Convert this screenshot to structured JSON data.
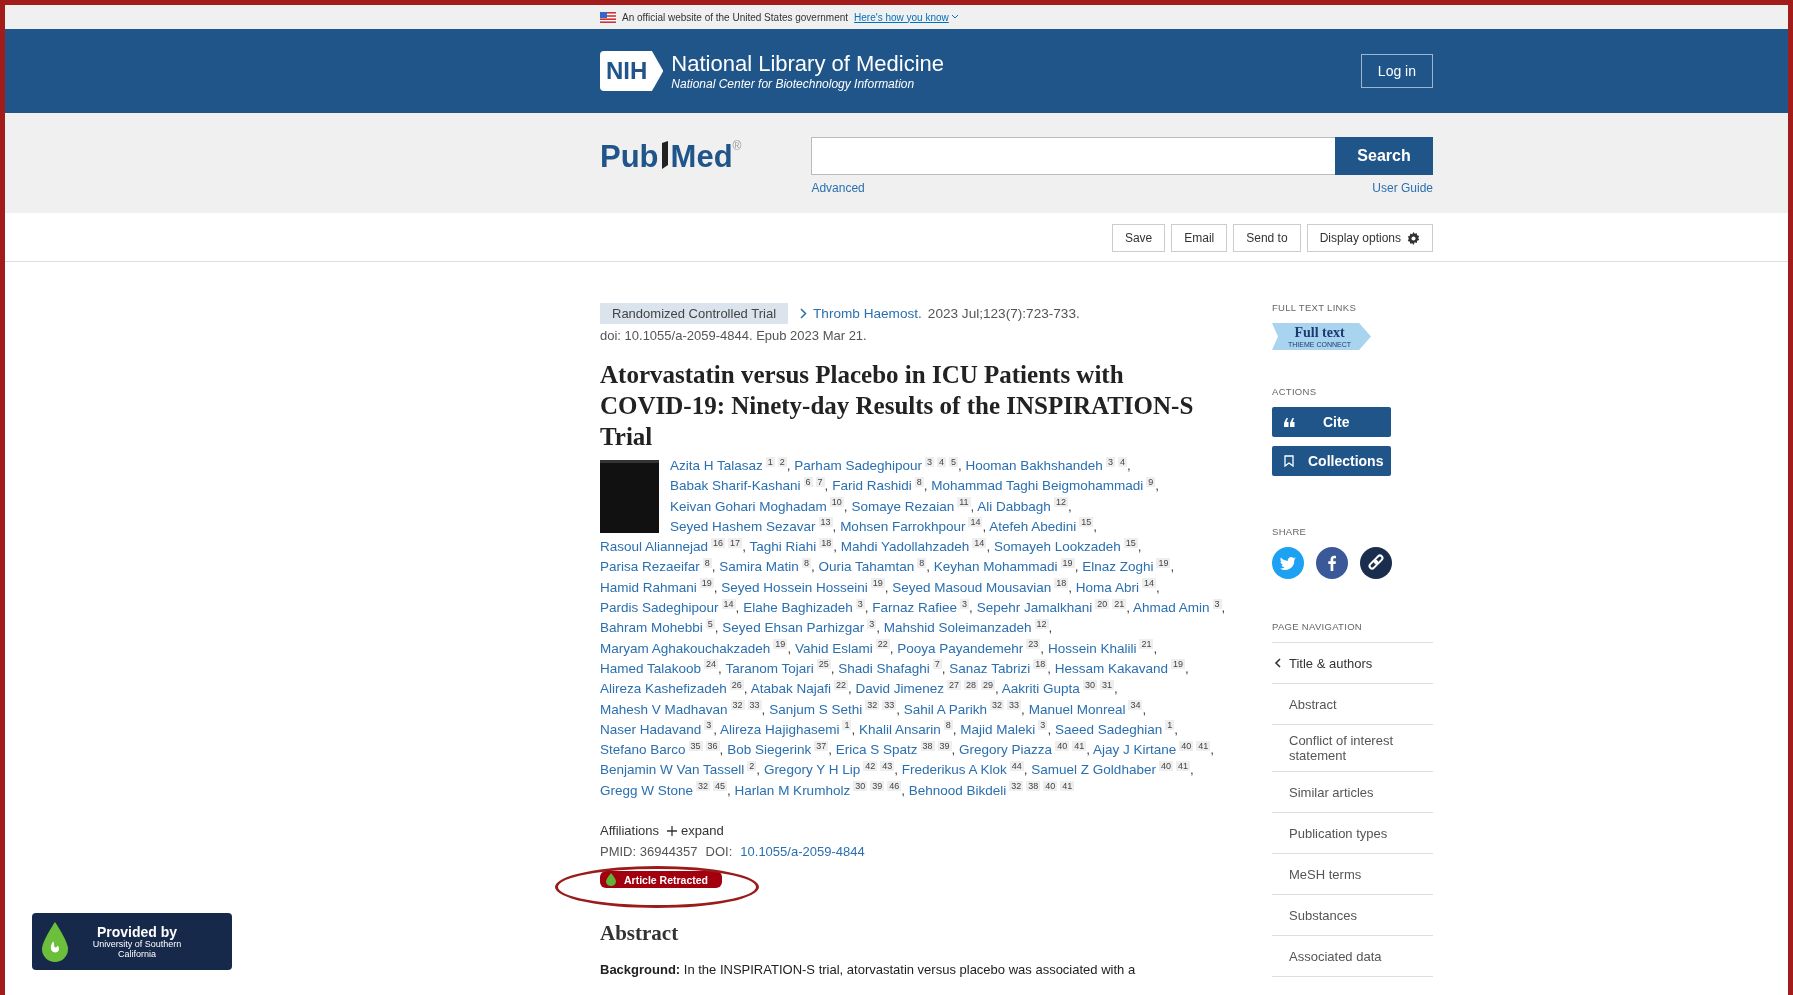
{
  "gov_banner": {
    "text": "An official website of the United States government",
    "link": "Here's how you know"
  },
  "header": {
    "logo_text": "NIH",
    "title": "National Library of Medicine",
    "subtitle": "National Center for Biotechnology Information",
    "login": "Log in"
  },
  "search": {
    "logo_parts": [
      "Pub",
      "Med"
    ],
    "logo_mark": "®",
    "button": "Search",
    "advanced": "Advanced",
    "user_guide": "User Guide"
  },
  "toolbar": [
    "Save",
    "Email",
    "Send to",
    "Display options"
  ],
  "article": {
    "publication_type": "Randomized Controlled Trial",
    "journal": "Thromb Haemost.",
    "citation": "2023 Jul;123(7):723-733.",
    "doi_line": "doi: 10.1055/a-2059-4844. Epub 2023 Mar 21.",
    "title": "Atorvastatin versus Placebo in ICU Patients with COVID-19: Ninety-day Results of the INSPIRATION-S Trial",
    "authors": [
      {
        "name": "Azita H Talasaz",
        "affiliations": [
          "1",
          "2"
        ]
      },
      {
        "name": "Parham Sadeghipour",
        "affiliations": [
          "3",
          "4",
          "5"
        ]
      },
      {
        "name": "Hooman Bakhshandeh",
        "affiliations": [
          "3",
          "4"
        ]
      },
      {
        "name": "Babak Sharif-Kashani",
        "affiliations": [
          "6",
          "7"
        ]
      },
      {
        "name": "Farid Rashidi",
        "affiliations": [
          "8"
        ]
      },
      {
        "name": "Mohammad Taghi Beigmohammadi",
        "affiliations": [
          "9"
        ]
      },
      {
        "name": "Keivan Gohari Moghadam",
        "affiliations": [
          "10"
        ]
      },
      {
        "name": "Somaye Rezaian",
        "affiliations": [
          "11"
        ]
      },
      {
        "name": "Ali Dabbagh",
        "affiliations": [
          "12"
        ]
      },
      {
        "name": "Seyed Hashem Sezavar",
        "affiliations": [
          "13"
        ]
      },
      {
        "name": "Mohsen Farrokhpour",
        "affiliations": [
          "14"
        ]
      },
      {
        "name": "Atefeh Abedini",
        "affiliations": [
          "15"
        ]
      },
      {
        "name": "Rasoul Aliannejad",
        "affiliations": [
          "16",
          "17"
        ]
      },
      {
        "name": "Taghi Riahi",
        "affiliations": [
          "18"
        ]
      },
      {
        "name": "Mahdi Yadollahzadeh",
        "affiliations": [
          "14"
        ]
      },
      {
        "name": "Somayeh Lookzadeh",
        "affiliations": [
          "15"
        ]
      },
      {
        "name": "Parisa Rezaeifar",
        "affiliations": [
          "8"
        ]
      },
      {
        "name": "Samira Matin",
        "affiliations": [
          "8"
        ]
      },
      {
        "name": "Ouria Tahamtan",
        "affiliations": [
          "8"
        ]
      },
      {
        "name": "Keyhan Mohammadi",
        "affiliations": [
          "19"
        ]
      },
      {
        "name": "Elnaz Zoghi",
        "affiliations": [
          "19"
        ]
      },
      {
        "name": "Hamid Rahmani",
        "affiliations": [
          "19"
        ]
      },
      {
        "name": "Seyed Hossein Hosseini",
        "affiliations": [
          "19"
        ]
      },
      {
        "name": "Seyed Masoud Mousavian",
        "affiliations": [
          "18"
        ]
      },
      {
        "name": "Homa Abri",
        "affiliations": [
          "14"
        ]
      },
      {
        "name": "Pardis Sadeghipour",
        "affiliations": [
          "14"
        ]
      },
      {
        "name": "Elahe Baghizadeh",
        "affiliations": [
          "3"
        ]
      },
      {
        "name": "Farnaz Rafiee",
        "affiliations": [
          "3"
        ]
      },
      {
        "name": "Sepehr Jamalkhani",
        "affiliations": [
          "20",
          "21"
        ]
      },
      {
        "name": "Ahmad Amin",
        "affiliations": [
          "3"
        ]
      },
      {
        "name": "Bahram Mohebbi",
        "affiliations": [
          "5"
        ]
      },
      {
        "name": "Seyed Ehsan Parhizgar",
        "affiliations": [
          "3"
        ]
      },
      {
        "name": "Mahshid Soleimanzadeh",
        "affiliations": [
          "12"
        ]
      },
      {
        "name": "Maryam Aghakouchakzadeh",
        "affiliations": [
          "19"
        ]
      },
      {
        "name": "Vahid Eslami",
        "affiliations": [
          "22"
        ]
      },
      {
        "name": "Pooya Payandemehr",
        "affiliations": [
          "23"
        ]
      },
      {
        "name": "Hossein Khalili",
        "affiliations": [
          "21"
        ]
      },
      {
        "name": "Hamed Talakoob",
        "affiliations": [
          "24"
        ]
      },
      {
        "name": "Taranom Tojari",
        "affiliations": [
          "25"
        ]
      },
      {
        "name": "Shadi Shafaghi",
        "affiliations": [
          "7"
        ]
      },
      {
        "name": "Sanaz Tabrizi",
        "affiliations": [
          "18"
        ]
      },
      {
        "name": "Hessam Kakavand",
        "affiliations": [
          "19"
        ]
      },
      {
        "name": "Alireza Kashefizadeh",
        "affiliations": [
          "26"
        ]
      },
      {
        "name": "Atabak Najafi",
        "affiliations": [
          "22"
        ]
      },
      {
        "name": "David Jimenez",
        "affiliations": [
          "27",
          "28",
          "29"
        ]
      },
      {
        "name": "Aakriti Gupta",
        "affiliations": [
          "30",
          "31"
        ]
      },
      {
        "name": "Mahesh V Madhavan",
        "affiliations": [
          "32",
          "33"
        ]
      },
      {
        "name": "Sanjum S Sethi",
        "affiliations": [
          "32",
          "33"
        ]
      },
      {
        "name": "Sahil A Parikh",
        "affiliations": [
          "32",
          "33"
        ]
      },
      {
        "name": "Manuel Monreal",
        "affiliations": [
          "34"
        ]
      },
      {
        "name": "Naser Hadavand",
        "affiliations": [
          "3"
        ]
      },
      {
        "name": "Alireza Hajighasemi",
        "affiliations": [
          "1"
        ]
      },
      {
        "name": "Khalil Ansarin",
        "affiliations": [
          "8"
        ]
      },
      {
        "name": "Majid Maleki",
        "affiliations": [
          "3"
        ]
      },
      {
        "name": "Saeed Sadeghian",
        "affiliations": [
          "1"
        ]
      },
      {
        "name": "Stefano Barco",
        "affiliations": [
          "35",
          "36"
        ]
      },
      {
        "name": "Bob Siegerink",
        "affiliations": [
          "37"
        ]
      },
      {
        "name": "Erica S Spatz",
        "affiliations": [
          "38",
          "39"
        ]
      },
      {
        "name": "Gregory Piazza",
        "affiliations": [
          "40",
          "41"
        ]
      },
      {
        "name": "Ajay J Kirtane",
        "affiliations": [
          "40",
          "41"
        ]
      },
      {
        "name": "Benjamin W Van Tassell",
        "affiliations": [
          "2"
        ]
      },
      {
        "name": "Gregory Y H Lip",
        "affiliations": [
          "42",
          "43"
        ]
      },
      {
        "name": "Frederikus A Klok",
        "affiliations": [
          "44"
        ]
      },
      {
        "name": "Samuel Z Goldhaber",
        "affiliations": [
          "40",
          "41"
        ]
      },
      {
        "name": "Gregg W Stone",
        "affiliations": [
          "32",
          "45"
        ]
      },
      {
        "name": "Harlan M Krumholz",
        "affiliations": [
          "30",
          "39",
          "46"
        ]
      },
      {
        "name": "Behnood Bikdeli",
        "affiliations": [
          "32",
          "38",
          "40",
          "41"
        ]
      }
    ],
    "separator": ",",
    "affiliations_label": "Affiliations",
    "expand": "expand",
    "pmid": "PMID: 36944357",
    "doi_label": "DOI:",
    "doi": "10.1055/a-2059-4844",
    "retraction_badge": "Article Retracted",
    "abstract_heading": "Abstract",
    "abstract_label": "Background:",
    "abstract_text": "In the INSPIRATION-S trial, atorvastatin versus placebo was associated with a"
  },
  "sidebar": {
    "full_text_heading": "FULL TEXT LINKS",
    "full_text": "Full text",
    "full_text_provider": "THIEME CONNECT",
    "actions_heading": "ACTIONS",
    "cite": "Cite",
    "collections": "Collections",
    "share_heading": "SHARE",
    "nav_heading": "PAGE NAVIGATION",
    "nav": [
      {
        "label": "Title & authors",
        "selected": true
      },
      {
        "label": "Abstract",
        "selected": false
      },
      {
        "label": "Conflict of interest statement",
        "selected": false
      },
      {
        "label": "Similar articles",
        "selected": false
      },
      {
        "label": "Publication types",
        "selected": false
      },
      {
        "label": "MeSH terms",
        "selected": false
      },
      {
        "label": "Substances",
        "selected": false
      },
      {
        "label": "Associated data",
        "selected": false
      }
    ]
  },
  "provider_badge": {
    "title": "Provided by",
    "subtitle": "University of Southern California"
  }
}
